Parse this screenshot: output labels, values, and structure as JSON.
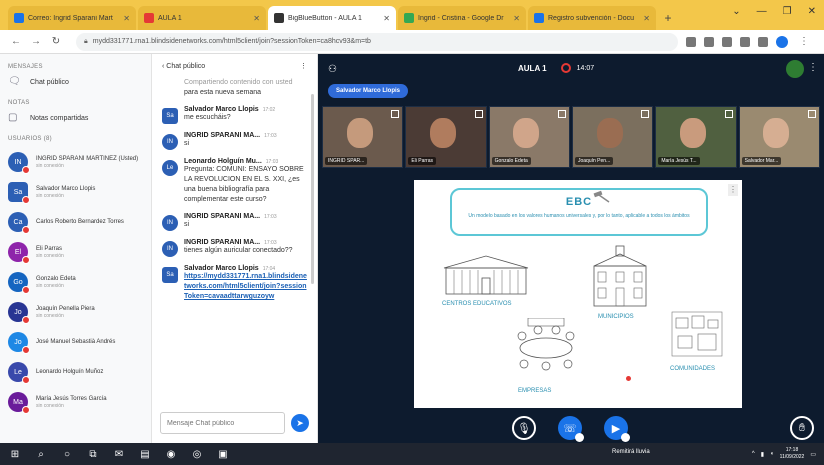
{
  "browser": {
    "tabs": [
      {
        "title": "Correo: Ingrid Sparani Mart",
        "color": "#1a73e8",
        "active": false
      },
      {
        "title": "AULA 1",
        "color": "#e53935",
        "active": false
      },
      {
        "title": "BigBlueButton - AULA 1",
        "color": "#333333",
        "active": true
      },
      {
        "title": "Ingrid - Cristina - Google Dr",
        "color": "#34a853",
        "active": false
      },
      {
        "title": "Registro subvención - Docu",
        "color": "#1a73e8",
        "active": false
      }
    ],
    "url": "mydd331771.rna1.blindsidenetworks.com/html5client/join?sessionToken=ca8hcv93&m=tb",
    "window_controls": [
      "⌄",
      "—",
      "❐",
      "✕"
    ]
  },
  "userpanel": {
    "messages_section": "MENSAJES",
    "public_chat": "Chat público",
    "notes_section": "NOTAS",
    "shared_notes": "Notas compartidas",
    "users_section": "USUARIOS (8)",
    "users": [
      {
        "initials": "IN",
        "name": "INGRID SPARANI MARTINEZ (Usted)",
        "sub": "sin conexión",
        "color": "#2c5fb4",
        "square": false
      },
      {
        "initials": "Sa",
        "name": "Salvador Marco Llopis",
        "sub": "sin conexión",
        "color": "#2c5fb4",
        "square": true
      },
      {
        "initials": "Ca",
        "name": "Carlos Roberto Bernardez Torres",
        "sub": "",
        "color": "#2c5fb4",
        "square": false
      },
      {
        "initials": "El",
        "name": "Eli Parras",
        "sub": "sin conexión",
        "color": "#8e24aa",
        "square": false
      },
      {
        "initials": "Go",
        "name": "Gonzalo Edeta",
        "sub": "sin conexión",
        "color": "#1565c0",
        "square": false
      },
      {
        "initials": "Jo",
        "name": "Joaquín Penella Piera",
        "sub": "sin conexión",
        "color": "#283593",
        "square": false
      },
      {
        "initials": "Jo",
        "name": "José Manuel Sebastià Andrés",
        "sub": "",
        "color": "#1e88e5",
        "square": false
      },
      {
        "initials": "Le",
        "name": "Leonardo Holguín Muñoz",
        "sub": "",
        "color": "#3949ab",
        "square": false
      },
      {
        "initials": "Ma",
        "name": "María Jesús Torres García",
        "sub": "sin conexión",
        "color": "#6a1b9a",
        "square": false
      }
    ]
  },
  "chat": {
    "header": "Chat público",
    "messages": [
      {
        "type": "text",
        "text": "para esta nueva semana",
        "muted_prefix": "Compartiendo contenido con usted"
      },
      {
        "initials": "Sa",
        "square": true,
        "name": "Salvador Marco Llopis",
        "time": "17:02",
        "text": "me escucháis?"
      },
      {
        "initials": "IN",
        "square": false,
        "name": "INGRID SPARANI MA...",
        "time": "17:03",
        "text": "si"
      },
      {
        "initials": "Le",
        "square": false,
        "name": "Leonardo Holguín Mu...",
        "time": "17:03",
        "text": "Pregunta: COMUNI: ENSAYO SOBRE LA REVOLUCION EN EL S. XXI, ¿es una buena bibliografía para complementar este curso?"
      },
      {
        "initials": "IN",
        "square": false,
        "name": "INGRID SPARANI MA...",
        "time": "17:03",
        "text": "si"
      },
      {
        "initials": "IN",
        "square": false,
        "name": "INGRID SPARANI MA...",
        "time": "17:03",
        "text": "tienes algún auricular conectado??"
      },
      {
        "initials": "Sa",
        "square": true,
        "name": "Salvador Marco Llopis",
        "time": "17:04",
        "link": "https://mydd331771.rna1.blindsidenetworks.com/html5client/join?sessionToken=cavaadttarwguzoyw"
      }
    ],
    "input_placeholder": "Mensaje Chat público",
    "send_icon": "➤"
  },
  "main": {
    "room_title": "AULA 1",
    "rec_time": "14:07",
    "presenter_label": "Salvador Marco Llopis",
    "videos": [
      {
        "label": "INGRID SPAR...",
        "bg": "#6b5a4d",
        "skin": "#c59a7c"
      },
      {
        "label": "Eli Parras",
        "bg": "#4b3b35",
        "skin": "#b07c5e"
      },
      {
        "label": "Gonzalo Edeta",
        "bg": "#8a7968",
        "skin": "#d0a58a"
      },
      {
        "label": "Joaquín Pen...",
        "bg": "#7b6f5e",
        "skin": "#9a6d52"
      },
      {
        "label": "María Jesús T...",
        "bg": "#506040",
        "skin": "#c99b7d"
      },
      {
        "label": "Salvador Mar...",
        "bg": "#9a8a70",
        "skin": "#d6ae92"
      }
    ]
  },
  "slide": {
    "title": "EBC",
    "subtitle": "Un modelo basado en los valores humanos universales y, por lo tanto, aplicable a todos los ámbitos",
    "captions": {
      "schools": "CENTROS EDUCATIVOS",
      "municipalities": "MUNICIPIOS",
      "companies": "EMPRESAS",
      "communities": "COMUNIDADES"
    }
  },
  "taskbar": {
    "weather": "Remitirá lluvia",
    "time": "17:18",
    "date": "11/09/2022"
  }
}
